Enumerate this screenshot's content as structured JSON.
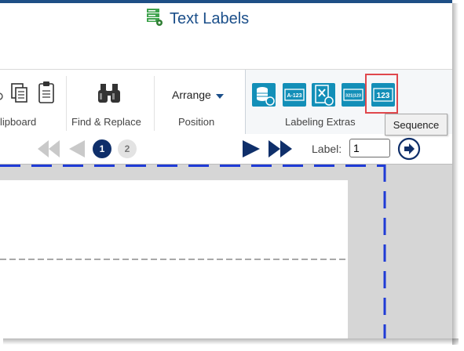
{
  "window": {
    "title": "Text Labels"
  },
  "ribbon": {
    "groups": {
      "clipboard": "Clipboard",
      "clipboard_visible": "lipboard",
      "find_replace": "Find & Replace",
      "position": "Position",
      "labeling_extras": "Labeling Extras"
    },
    "arrange_label": "Arrange",
    "extras_icons": {
      "database": "database-icon",
      "a123": "A-123",
      "delete": "delete-field-icon",
      "range": "321|123",
      "sequence": "123"
    },
    "tooltip": "Sequence"
  },
  "navigation": {
    "pages": [
      "1",
      "2"
    ],
    "active_page": "1",
    "label_caption": "Label:",
    "label_value": "1"
  },
  "colors": {
    "accent": "#1b4f8a",
    "teal": "#138fb8",
    "highlight": "#e0474c",
    "guide": "#1f3bd6"
  }
}
